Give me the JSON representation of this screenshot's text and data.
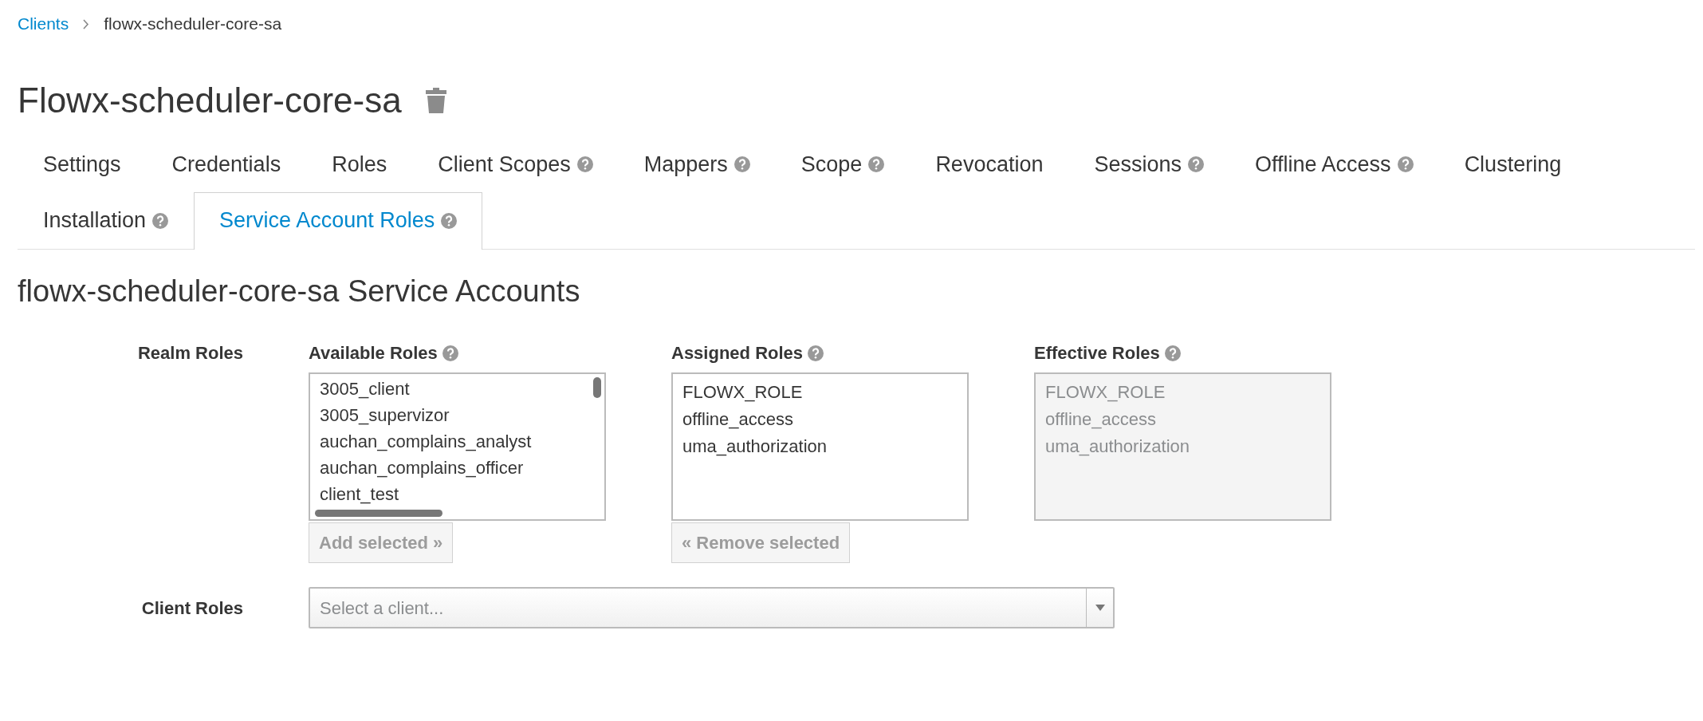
{
  "breadcrumb": [
    {
      "label": "Clients",
      "link": true
    },
    {
      "label": "flowx-scheduler-core-sa",
      "link": false
    }
  ],
  "title": "Flowx-scheduler-core-sa",
  "tab_rows": [
    [
      {
        "label": "Settings",
        "help": false,
        "selected": false
      },
      {
        "label": "Credentials",
        "help": false,
        "selected": false
      },
      {
        "label": "Roles",
        "help": false,
        "selected": false
      },
      {
        "label": "Client Scopes",
        "help": true,
        "selected": false
      },
      {
        "label": "Mappers",
        "help": true,
        "selected": false
      },
      {
        "label": "Scope",
        "help": true,
        "selected": false
      },
      {
        "label": "Revocation",
        "help": false,
        "selected": false
      },
      {
        "label": "Sessions",
        "help": true,
        "selected": false
      },
      {
        "label": "Offline Access",
        "help": true,
        "selected": false
      },
      {
        "label": "Clustering",
        "help": false,
        "selected": false
      }
    ],
    [
      {
        "label": "Installation",
        "help": true,
        "selected": false
      },
      {
        "label": "Service Account Roles",
        "help": true,
        "selected": true
      }
    ]
  ],
  "section_title": "flowx-scheduler-core-sa Service Accounts",
  "realm_roles": {
    "label": "Realm Roles",
    "lists": [
      {
        "label": "Available Roles",
        "disabled": false,
        "items": [
          "3005_client",
          "3005_supervizor",
          "auchan_complains_analyst",
          "auchan_complains_officer",
          "client_test"
        ],
        "button": {
          "label": "Add selected »",
          "disabled": true
        }
      },
      {
        "label": "Assigned Roles",
        "disabled": false,
        "items": [
          "FLOWX_ROLE",
          "offline_access",
          "uma_authorization"
        ],
        "button": {
          "label": "« Remove selected",
          "disabled": true
        }
      },
      {
        "label": "Effective Roles",
        "disabled": true,
        "items": [
          "FLOWX_ROLE",
          "offline_access",
          "uma_authorization"
        ]
      }
    ]
  },
  "client_roles": {
    "label": "Client Roles",
    "placeholder": "Select a client..."
  }
}
